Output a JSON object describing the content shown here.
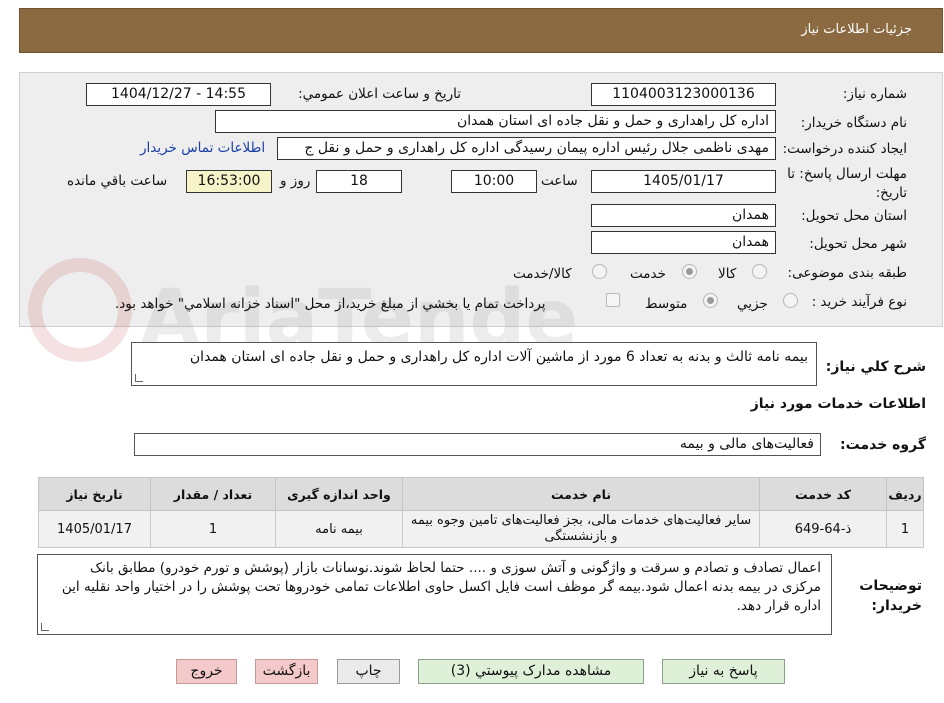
{
  "header": {
    "title": "جزئیات اطلاعات نیاز"
  },
  "need_number": {
    "label": "شماره نیاز:",
    "value": "1104003123000136"
  },
  "announce_date": {
    "label": "تاریخ و ساعت اعلان عمومي:",
    "value": "1404/12/27 - 14:55"
  },
  "buyer_org": {
    "label": "نام دستگاه خريدار:",
    "value": "اداره کل راهداری و حمل و نقل جاده ای استان همدان"
  },
  "requester": {
    "label": "ايجاد کننده درخواست:",
    "value": "مهدی ناظمی جلال رئیس اداره پیمان رسیدگی اداره کل راهداری و حمل و نقل ج",
    "contact_link": "اطلاعات تماس خريدار"
  },
  "deadline": {
    "label": "مهلت ارسال پاسخ: تا تاریخ:",
    "date": "1405/01/17",
    "time_label": "ساعت",
    "time": "10:00",
    "days": "18",
    "days_label": "روز و",
    "remaining": "16:53:00",
    "remaining_label": "ساعت باقي مانده"
  },
  "delivery_province": {
    "label": "استان محل تحويل:",
    "value": "همدان"
  },
  "delivery_city": {
    "label": "شهر محل تحويل:",
    "value": "همدان"
  },
  "category": {
    "label": "طبقه بندی موضوعی:",
    "options": [
      "کالا",
      "خدمت",
      "کالا/خدمت"
    ],
    "selected": "خدمت"
  },
  "process": {
    "label": "نوع فرآیند خرید :",
    "options": [
      "جزيي",
      "متوسط"
    ],
    "selected": "متوسط",
    "note": "پرداخت تمام يا بخشي از مبلغ خريد،از محل \"اسناد خزانه اسلامي\" خواهد بود."
  },
  "description": {
    "label": "شرح کلي نياز:",
    "value": "بیمه نامه ثالث و بدنه به تعداد 6 مورد از ماشین آلات اداره کل راهداری و حمل و نقل جاده ای استان همدان"
  },
  "services_title": "اطلاعات خدمات مورد نياز",
  "service_group": {
    "label": "گروه خدمت:",
    "value": "فعالیت‌های مالی و بیمه"
  },
  "table": {
    "headers": [
      "رديف",
      "کد خدمت",
      "نام خدمت",
      "واحد اندازه گيری",
      "تعداد / مقدار",
      "تاريخ نياز"
    ],
    "rows": [
      [
        "1",
        "ذ-64-649",
        "سایر فعالیت‌های خدمات مالی، بجز فعالیت‌های تامین وجوه بیمه و بازنشستگی",
        "بیمه نامه",
        "1",
        "1405/01/17"
      ]
    ]
  },
  "buyer_notes": {
    "label": "توضيحات خريدار:",
    "value": "اعمال تصادف و تصادم و سرقت و واژگونی و آتش سوزی و .... حتما لحاظ شوند.نوسانات بازار (پوشش و تورم خودرو) مطابق بانک مرکزی در بیمه بدنه اعمال شود.بیمه گر موظف است فایل اکسل حاوی اطلاعات تمامی خودروها تحت پوشش را در اختیار واحد نقلیه این اداره قرار دهد."
  },
  "buttons": {
    "reply": "پاسخ به نياز",
    "attachments": "مشاهده مدارک پيوستي (3)",
    "print": "چاپ",
    "back": "بازگشت",
    "exit": "خروج"
  },
  "watermark": "AriaTender.neT",
  "colors": {
    "header": "#8b6a42",
    "link": "#1a3ea8",
    "button_green": "#dff0d8",
    "button_red": "#f4c9c9"
  }
}
